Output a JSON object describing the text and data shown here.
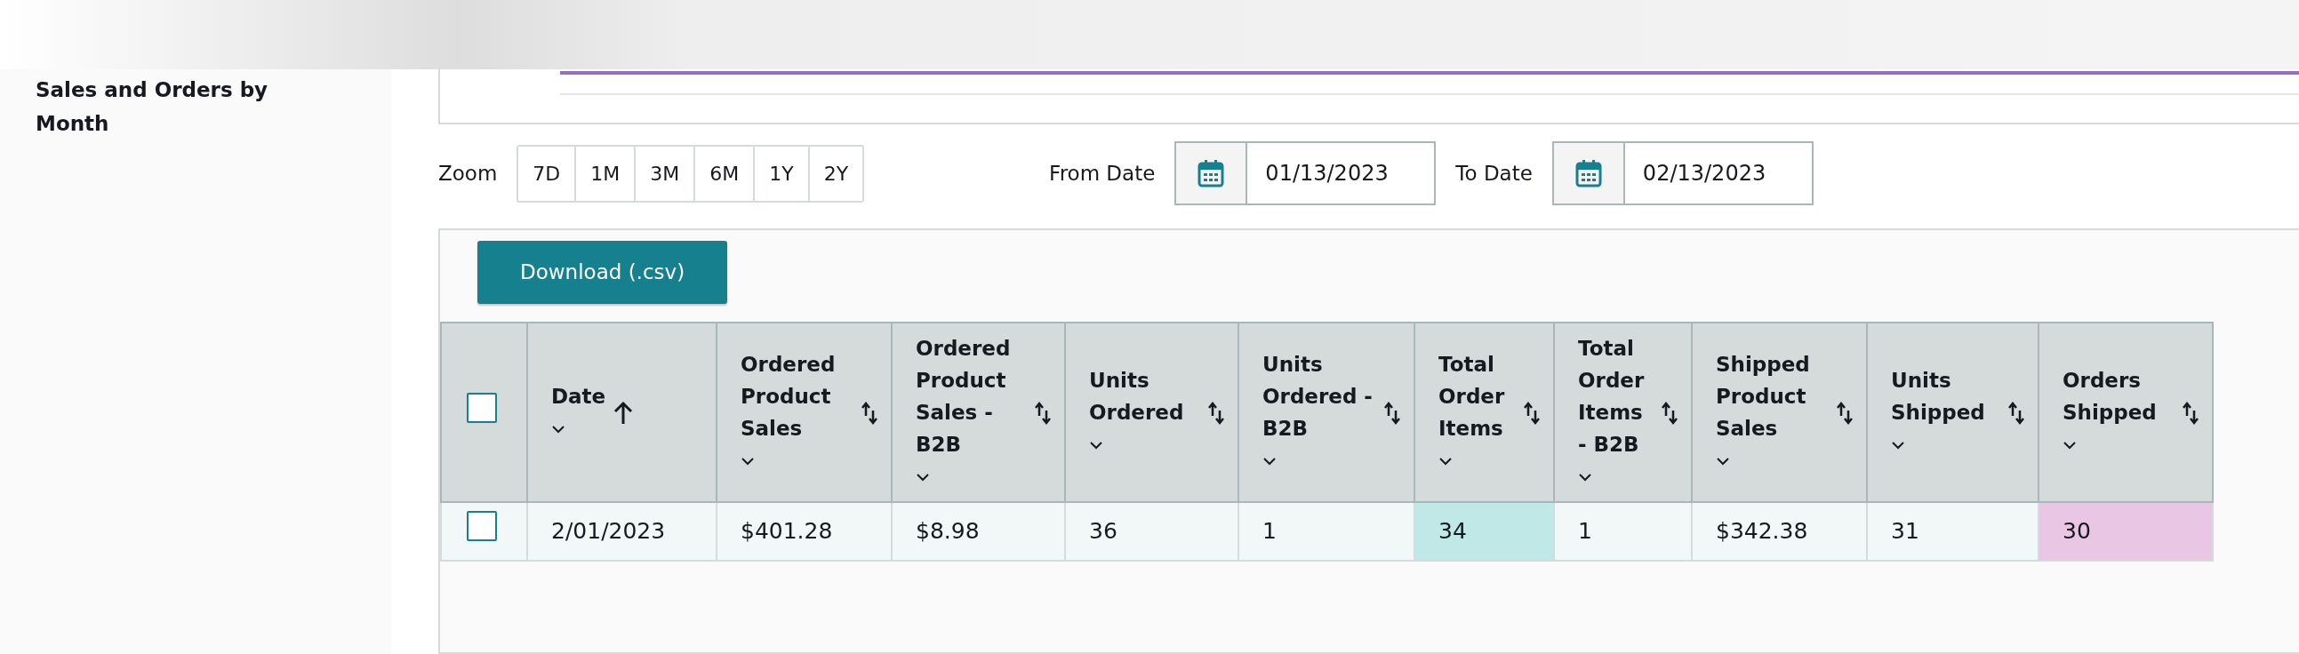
{
  "sidebar": {
    "title": "Sales and Orders by Month"
  },
  "toolbar": {
    "zoom_label": "Zoom",
    "zoom_options": [
      {
        "label": "7D",
        "selected": false
      },
      {
        "label": "1M",
        "selected": false
      },
      {
        "label": "3M",
        "selected": false
      },
      {
        "label": "6M",
        "selected": false
      },
      {
        "label": "1Y",
        "selected": false
      },
      {
        "label": "2Y",
        "selected": false
      }
    ],
    "from_label": "From Date",
    "from_value": "01/13/2023",
    "to_label": "To Date",
    "to_value": "02/13/2023"
  },
  "download_button": "Download (.csv)",
  "table": {
    "select_all_checked": false,
    "columns": [
      {
        "label": "Date",
        "sorted": true
      },
      {
        "label": "Ordered Product Sales",
        "sorted": false
      },
      {
        "label": "Ordered Product Sales - B2B",
        "sorted": false
      },
      {
        "label": "Units Ordered",
        "sorted": false
      },
      {
        "label": "Units Ordered - B2B",
        "sorted": false
      },
      {
        "label": "Total Order Items",
        "sorted": false
      },
      {
        "label": "Total Order Items - B2B",
        "sorted": false
      },
      {
        "label": "Shipped Product Sales",
        "sorted": false
      },
      {
        "label": "Units Shipped",
        "sorted": false
      },
      {
        "label": "Orders Shipped",
        "sorted": false
      }
    ],
    "rows": [
      {
        "checked": false,
        "cells": [
          {
            "text": "2/01/2023"
          },
          {
            "text": "$401.28"
          },
          {
            "text": "$8.98"
          },
          {
            "text": "36"
          },
          {
            "text": "1"
          },
          {
            "text": "34",
            "color": "#c0e8e6"
          },
          {
            "text": "1"
          },
          {
            "text": "$342.38"
          },
          {
            "text": "31"
          },
          {
            "text": "30",
            "color": "#e8c6e4"
          }
        ]
      }
    ]
  }
}
